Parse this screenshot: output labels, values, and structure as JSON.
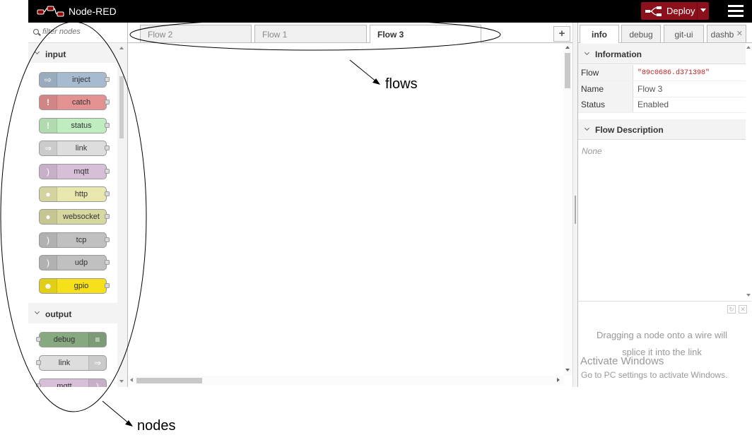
{
  "header": {
    "app_title": "Node-RED",
    "deploy_label": "Deploy"
  },
  "palette": {
    "filter_placeholder": "filter nodes",
    "categories": [
      {
        "name": "input",
        "nodes": [
          {
            "label": "inject",
            "color": "#a6bbcf"
          },
          {
            "label": "catch",
            "color": "#e49191"
          },
          {
            "label": "status",
            "color": "#c0edc0"
          },
          {
            "label": "link",
            "color": "#dddddd"
          },
          {
            "label": "mqtt",
            "color": "#d8bfd8"
          },
          {
            "label": "http",
            "color": "#e7e7ae"
          },
          {
            "label": "websocket",
            "color": "#d7d7a0"
          },
          {
            "label": "tcp",
            "color": "#c0c0c0"
          },
          {
            "label": "udp",
            "color": "#c0c0c0"
          },
          {
            "label": "gpio",
            "color": "#f5e01a"
          }
        ]
      },
      {
        "name": "output",
        "nodes": [
          {
            "label": "debug",
            "color": "#87a980"
          },
          {
            "label": "link",
            "color": "#dddddd"
          },
          {
            "label": "mqtt",
            "color": "#d8bfd8"
          }
        ]
      }
    ]
  },
  "workspace": {
    "tabs": [
      {
        "label": "Flow 2",
        "active": false
      },
      {
        "label": "Flow 1",
        "active": false
      },
      {
        "label": "Flow 3",
        "active": true
      }
    ],
    "add_tab": "+"
  },
  "sidebar": {
    "tabs": [
      {
        "label": "info",
        "active": true
      },
      {
        "label": "debug",
        "active": false
      },
      {
        "label": "git-ui",
        "active": false
      },
      {
        "label": "dashb",
        "active": false
      }
    ],
    "information": {
      "title": "Information",
      "rows": [
        {
          "key": "Flow",
          "value": "\"89c0686.d371398\""
        },
        {
          "key": "Name",
          "value": "Flow 3"
        },
        {
          "key": "Status",
          "value": "Enabled"
        }
      ]
    },
    "flow_description": {
      "title": "Flow Description",
      "text": "None"
    },
    "help_tip_line1": "Dragging a node onto a wire will",
    "help_tip_line2": "splice it into the link"
  },
  "watermark": {
    "line1": "Activate Windows",
    "line2": "Go to PC settings to activate Windows."
  },
  "annotations": {
    "flows": "flows",
    "nodes": "nodes"
  }
}
